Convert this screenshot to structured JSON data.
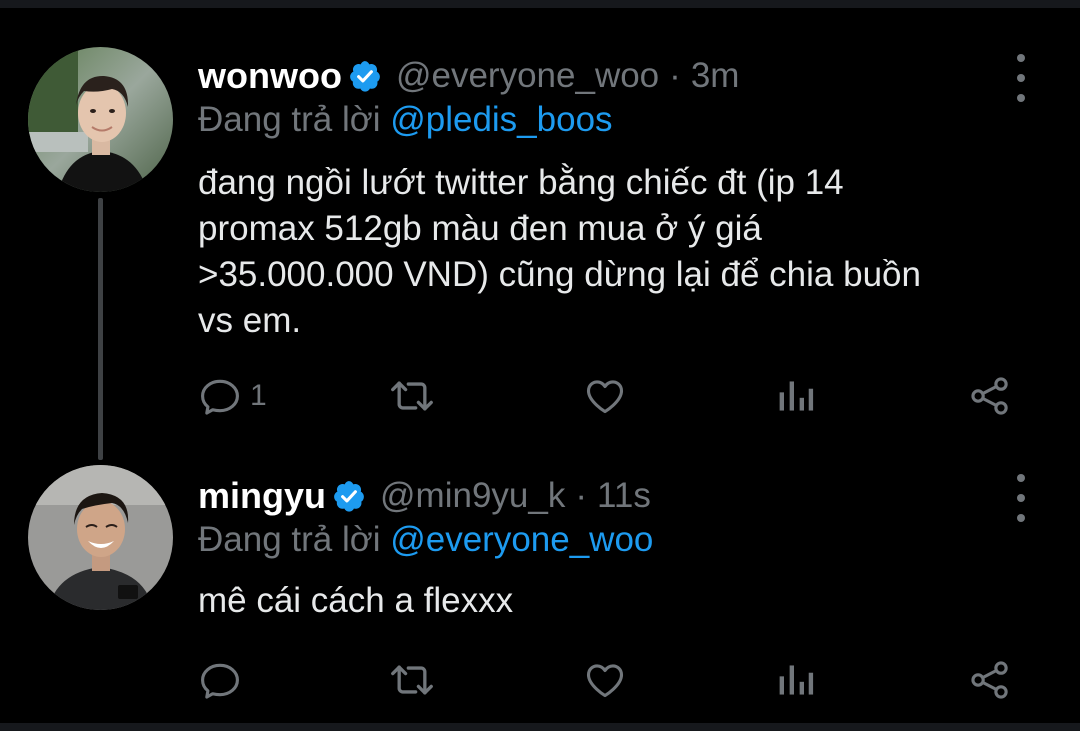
{
  "tweets": [
    {
      "display_name": "wonwoo",
      "handle": "@everyone_woo",
      "separator": "·",
      "time": "3m",
      "reply_prefix": "Đang trả lời",
      "reply_to": "@pledis_boos",
      "text_lines": [
        "đang ngồi lướt twitter bằng chiếc đt (ip 14",
        "promax 512gb màu đen mua ở ý giá",
        ">35.000.000 VND) cũng dừng lại để chia buồn",
        "vs em."
      ],
      "reply_count": "1",
      "verified": true
    },
    {
      "display_name": "mingyu",
      "handle": "@min9yu_k",
      "separator": "·",
      "time": "11s",
      "reply_prefix": "Đang trả lời",
      "reply_to": "@everyone_woo",
      "text_lines": [
        "mê cái cách a flexxx"
      ],
      "reply_count": "",
      "verified": true
    }
  ],
  "colors": {
    "background": "#000000",
    "primary_text": "#e7e9ea",
    "secondary_text": "#71767b",
    "accent": "#1d9bf0",
    "thread_line": "#3e4144"
  },
  "icons": {
    "reply": "reply-bubble-icon",
    "retweet": "retweet-icon",
    "like": "heart-icon",
    "views": "analytics-bars-icon",
    "share": "share-nodes-icon",
    "more": "vertical-ellipsis-icon",
    "verified": "verified-badge-icon"
  }
}
